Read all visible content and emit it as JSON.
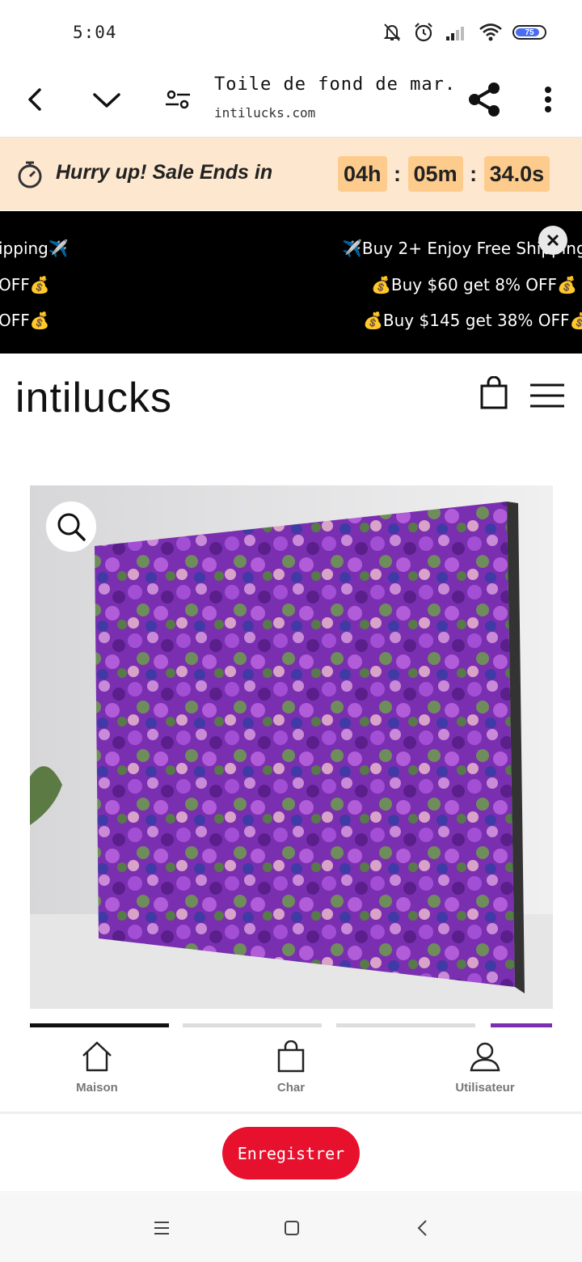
{
  "status_bar": {
    "time": "5:04",
    "battery_level": "75",
    "icons": [
      "bell-muted-icon",
      "alarm-icon",
      "signal-icon",
      "wifi-icon",
      "battery-icon"
    ]
  },
  "browser": {
    "page_title": "Toile de fond de mar...",
    "domain": "intilucks.com",
    "icons": [
      "back-arrow-icon",
      "chevron-down-icon",
      "tune-icon",
      "share-icon",
      "more-vert-icon"
    ]
  },
  "sale_banner": {
    "text": "Hurry up! Sale Ends in",
    "hours": "04h",
    "minutes": "05m",
    "seconds": "34.0s",
    "separator": ":",
    "background": "#fde8cf",
    "timer_color": "#fdcb8c"
  },
  "promo": {
    "left_lines": [
      "ipping✈️",
      "OFF💰",
      " OFF💰"
    ],
    "right_lines": [
      "✈️Buy 2+ Enjoy Free Shipping",
      "💰Buy $60 get 8% OFF💰",
      "💰Buy $145 get 38% OFF💰"
    ],
    "background": "#000000"
  },
  "site": {
    "logo": "intilucks",
    "icons": [
      "shopping-bag-icon",
      "hamburger-menu-icon"
    ]
  },
  "gallery": {
    "icons": [
      "zoom-icon"
    ]
  },
  "bottom_nav": {
    "items": [
      {
        "label": "Maison",
        "icon": "home-icon"
      },
      {
        "label": "Char",
        "icon": "bag-icon"
      },
      {
        "label": "Utilisateur",
        "icon": "user-icon"
      }
    ]
  },
  "register": {
    "label": "Enregistrer",
    "color": "#e8112d"
  },
  "system_nav": {
    "icons": [
      "menu-icon",
      "home-square-icon",
      "back-icon"
    ]
  }
}
